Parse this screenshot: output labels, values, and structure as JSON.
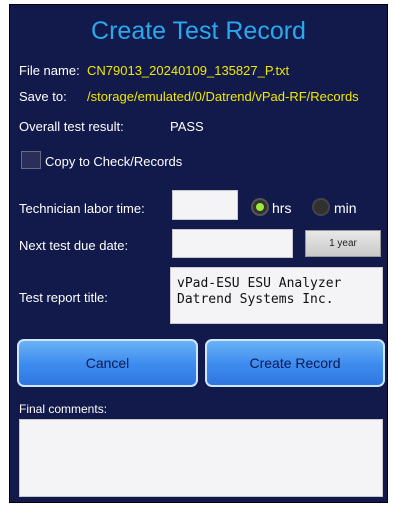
{
  "dialog": {
    "title": "Create Test Record",
    "file_name_label": "File name:",
    "file_name_value": "CN79013_20240109_135827_P.txt",
    "save_to_label": "Save to:",
    "save_to_value": "/storage/emulated/0/Datrend/vPad-RF/Records",
    "overall_label": "Overall test result:",
    "overall_value": "PASS",
    "copy_label": "Copy to Check/Records",
    "copy_checked": false,
    "labor_label": "Technician labor time:",
    "labor_value": "",
    "unit_hrs": "hrs",
    "unit_min": "min",
    "unit_selected": "hrs",
    "due_label": "Next test due date:",
    "due_value": "",
    "year_button": "1 year",
    "report_title_label": "Test report title:",
    "report_title_value": "vPad-ESU ESU Analyzer\nDatrend Systems Inc.",
    "cancel_button": "Cancel",
    "create_button": "Create Record",
    "comments_label": "Final comments:",
    "comments_value": ""
  },
  "colors": {
    "background": "#111a4a",
    "title": "#2aa8ee",
    "highlight_text": "#f2e800",
    "button_blue": "#3f8df0",
    "radio_selected": "#9ee83a"
  }
}
